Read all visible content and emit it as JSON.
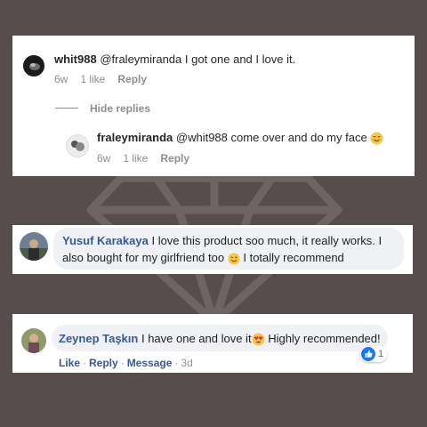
{
  "instagram": {
    "comment1": {
      "username": "whit988",
      "text": "@fraleymiranda I got one and I love it.",
      "age": "6w",
      "likes": "1 like",
      "reply": "Reply"
    },
    "hide_replies": "Hide replies",
    "comment2": {
      "username": "fraleymiranda",
      "text": "@whit988 come over and do my face",
      "age": "6w",
      "likes": "1 like",
      "reply": "Reply"
    }
  },
  "facebook1": {
    "name": "Yusuf Karakaya",
    "line1": "I love this product soo much, it really works. I",
    "line2a": "also bought for my girlfriend too",
    "line2b": "I totally recommend"
  },
  "facebook2": {
    "name": "Zeynep Taşkın",
    "text": "I have one and love it",
    "text2": "Highly recommended!",
    "actions": {
      "like": "Like",
      "reply": "Reply",
      "message": "Message",
      "time": "3d"
    },
    "reaction_count": "1"
  },
  "colors": {
    "background": "#564d4c",
    "fb_link": "#385898",
    "bubble": "#eff1f4"
  }
}
